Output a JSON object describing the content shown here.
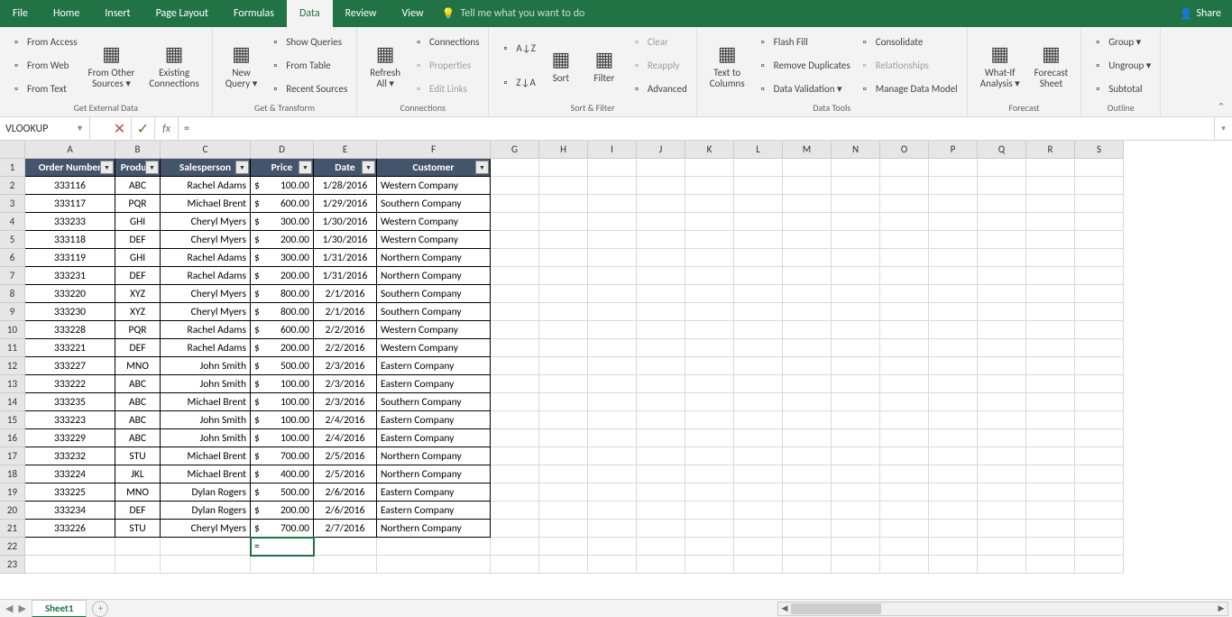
{
  "menuTabs": [
    "File",
    "Home",
    "Insert",
    "Page Layout",
    "Formulas",
    "Data",
    "Review",
    "View"
  ],
  "activeTab": "Data",
  "tellMe": "Tell me what you want to do",
  "share": "Share",
  "ribbon": {
    "groups": [
      {
        "label": "Get External Data",
        "big": [],
        "cols": [
          {
            "items": [
              {
                "t": "From Access",
                "n": "from-access"
              },
              {
                "t": "From Web",
                "n": "from-web"
              },
              {
                "t": "From Text",
                "n": "from-text"
              }
            ]
          },
          {
            "big": {
              "t1": "From Other",
              "t2": "Sources ▾",
              "n": "from-other-sources"
            }
          },
          {
            "big": {
              "t1": "Existing",
              "t2": "Connections",
              "n": "existing-connections"
            }
          }
        ]
      },
      {
        "label": "Get & Transform",
        "cols": [
          {
            "big": {
              "t1": "New",
              "t2": "Query ▾",
              "n": "new-query"
            }
          },
          {
            "items": [
              {
                "t": "Show Queries",
                "n": "show-queries"
              },
              {
                "t": "From Table",
                "n": "from-table"
              },
              {
                "t": "Recent Sources",
                "n": "recent-sources"
              }
            ]
          }
        ]
      },
      {
        "label": "Connections",
        "cols": [
          {
            "big": {
              "t1": "Refresh",
              "t2": "All ▾",
              "n": "refresh-all"
            }
          },
          {
            "items": [
              {
                "t": "Connections",
                "n": "connections"
              },
              {
                "t": "Properties",
                "n": "properties",
                "d": true
              },
              {
                "t": "Edit Links",
                "n": "edit-links",
                "d": true
              }
            ]
          }
        ]
      },
      {
        "label": "Sort & Filter",
        "cols": [
          {
            "items": [
              {
                "t": "A↓Z",
                "n": "sort-asc"
              },
              {
                "t": "Z↓A",
                "n": "sort-desc"
              }
            ]
          },
          {
            "big": {
              "t1": "Sort",
              "t2": "",
              "n": "sort"
            }
          },
          {
            "big": {
              "t1": "Filter",
              "t2": "",
              "n": "filter"
            }
          },
          {
            "items": [
              {
                "t": "Clear",
                "n": "clear",
                "d": true
              },
              {
                "t": "Reapply",
                "n": "reapply",
                "d": true
              },
              {
                "t": "Advanced",
                "n": "advanced"
              }
            ]
          }
        ]
      },
      {
        "label": "Data Tools",
        "cols": [
          {
            "big": {
              "t1": "Text to",
              "t2": "Columns",
              "n": "text-to-columns"
            }
          },
          {
            "items": [
              {
                "t": "Flash Fill",
                "n": "flash-fill"
              },
              {
                "t": "Remove Duplicates",
                "n": "remove-duplicates"
              },
              {
                "t": "Data Validation ▾",
                "n": "data-validation"
              }
            ]
          },
          {
            "items": [
              {
                "t": "Consolidate",
                "n": "consolidate"
              },
              {
                "t": "Relationships",
                "n": "relationships",
                "d": true
              },
              {
                "t": "Manage Data Model",
                "n": "manage-data-model"
              }
            ]
          }
        ]
      },
      {
        "label": "Forecast",
        "cols": [
          {
            "big": {
              "t1": "What-If",
              "t2": "Analysis ▾",
              "n": "what-if"
            }
          },
          {
            "big": {
              "t1": "Forecast",
              "t2": "Sheet",
              "n": "forecast-sheet"
            }
          }
        ]
      },
      {
        "label": "Outline",
        "cols": [
          {
            "items": [
              {
                "t": "Group ▾",
                "n": "group"
              },
              {
                "t": "Ungroup ▾",
                "n": "ungroup"
              },
              {
                "t": "Subtotal",
                "n": "subtotal"
              }
            ]
          }
        ]
      }
    ]
  },
  "nameBox": "VLOOKUP",
  "formula": "=",
  "colWidths": {
    "row": 28,
    "A": 100,
    "B": 50,
    "C": 100,
    "D": 70,
    "E": 70,
    "F": 126,
    "rest": 54
  },
  "colLetters": [
    "A",
    "B",
    "C",
    "D",
    "E",
    "F",
    "G",
    "H",
    "I",
    "J",
    "K",
    "L",
    "M",
    "N",
    "O",
    "P",
    "Q",
    "R",
    "S"
  ],
  "headers": [
    "Order Number",
    "Product",
    "Salesperson",
    "Price",
    "Date",
    "Customer"
  ],
  "activeCell": {
    "row": 22,
    "col": "D",
    "value": "="
  },
  "rows": [
    {
      "n": "333116",
      "p": "ABC",
      "s": "Rachel Adams",
      "pr": "100.00",
      "d": "1/28/2016",
      "c": "Western Company"
    },
    {
      "n": "333117",
      "p": "PQR",
      "s": "Michael Brent",
      "pr": "600.00",
      "d": "1/29/2016",
      "c": "Southern Company"
    },
    {
      "n": "333233",
      "p": "GHI",
      "s": "Cheryl Myers",
      "pr": "300.00",
      "d": "1/30/2016",
      "c": "Western Company"
    },
    {
      "n": "333118",
      "p": "DEF",
      "s": "Cheryl Myers",
      "pr": "200.00",
      "d": "1/30/2016",
      "c": "Western Company"
    },
    {
      "n": "333119",
      "p": "GHI",
      "s": "Rachel Adams",
      "pr": "300.00",
      "d": "1/31/2016",
      "c": "Northern Company"
    },
    {
      "n": "333231",
      "p": "DEF",
      "s": "Rachel Adams",
      "pr": "200.00",
      "d": "1/31/2016",
      "c": "Northern Company"
    },
    {
      "n": "333220",
      "p": "XYZ",
      "s": "Cheryl Myers",
      "pr": "800.00",
      "d": "2/1/2016",
      "c": "Southern Company"
    },
    {
      "n": "333230",
      "p": "XYZ",
      "s": "Cheryl Myers",
      "pr": "800.00",
      "d": "2/1/2016",
      "c": "Southern Company"
    },
    {
      "n": "333228",
      "p": "PQR",
      "s": "Rachel Adams",
      "pr": "600.00",
      "d": "2/2/2016",
      "c": "Western Company"
    },
    {
      "n": "333221",
      "p": "DEF",
      "s": "Rachel Adams",
      "pr": "200.00",
      "d": "2/2/2016",
      "c": "Western Company"
    },
    {
      "n": "333227",
      "p": "MNO",
      "s": "John Smith",
      "pr": "500.00",
      "d": "2/3/2016",
      "c": "Eastern Company"
    },
    {
      "n": "333222",
      "p": "ABC",
      "s": "John Smith",
      "pr": "100.00",
      "d": "2/3/2016",
      "c": "Eastern Company"
    },
    {
      "n": "333235",
      "p": "ABC",
      "s": "Michael Brent",
      "pr": "100.00",
      "d": "2/3/2016",
      "c": "Southern Company"
    },
    {
      "n": "333223",
      "p": "ABC",
      "s": "John Smith",
      "pr": "100.00",
      "d": "2/4/2016",
      "c": "Eastern Company"
    },
    {
      "n": "333229",
      "p": "ABC",
      "s": "John Smith",
      "pr": "100.00",
      "d": "2/4/2016",
      "c": "Eastern Company"
    },
    {
      "n": "333232",
      "p": "STU",
      "s": "Michael Brent",
      "pr": "700.00",
      "d": "2/5/2016",
      "c": "Northern Company"
    },
    {
      "n": "333224",
      "p": "JKL",
      "s": "Michael Brent",
      "pr": "400.00",
      "d": "2/5/2016",
      "c": "Northern Company"
    },
    {
      "n": "333225",
      "p": "MNO",
      "s": "Dylan Rogers",
      "pr": "500.00",
      "d": "2/6/2016",
      "c": "Eastern Company"
    },
    {
      "n": "333234",
      "p": "DEF",
      "s": "Dylan Rogers",
      "pr": "200.00",
      "d": "2/6/2016",
      "c": "Eastern Company"
    },
    {
      "n": "333226",
      "p": "STU",
      "s": "Cheryl Myers",
      "pr": "700.00",
      "d": "2/7/2016",
      "c": "Northern Company"
    }
  ],
  "sheetName": "Sheet1",
  "currency": "$"
}
